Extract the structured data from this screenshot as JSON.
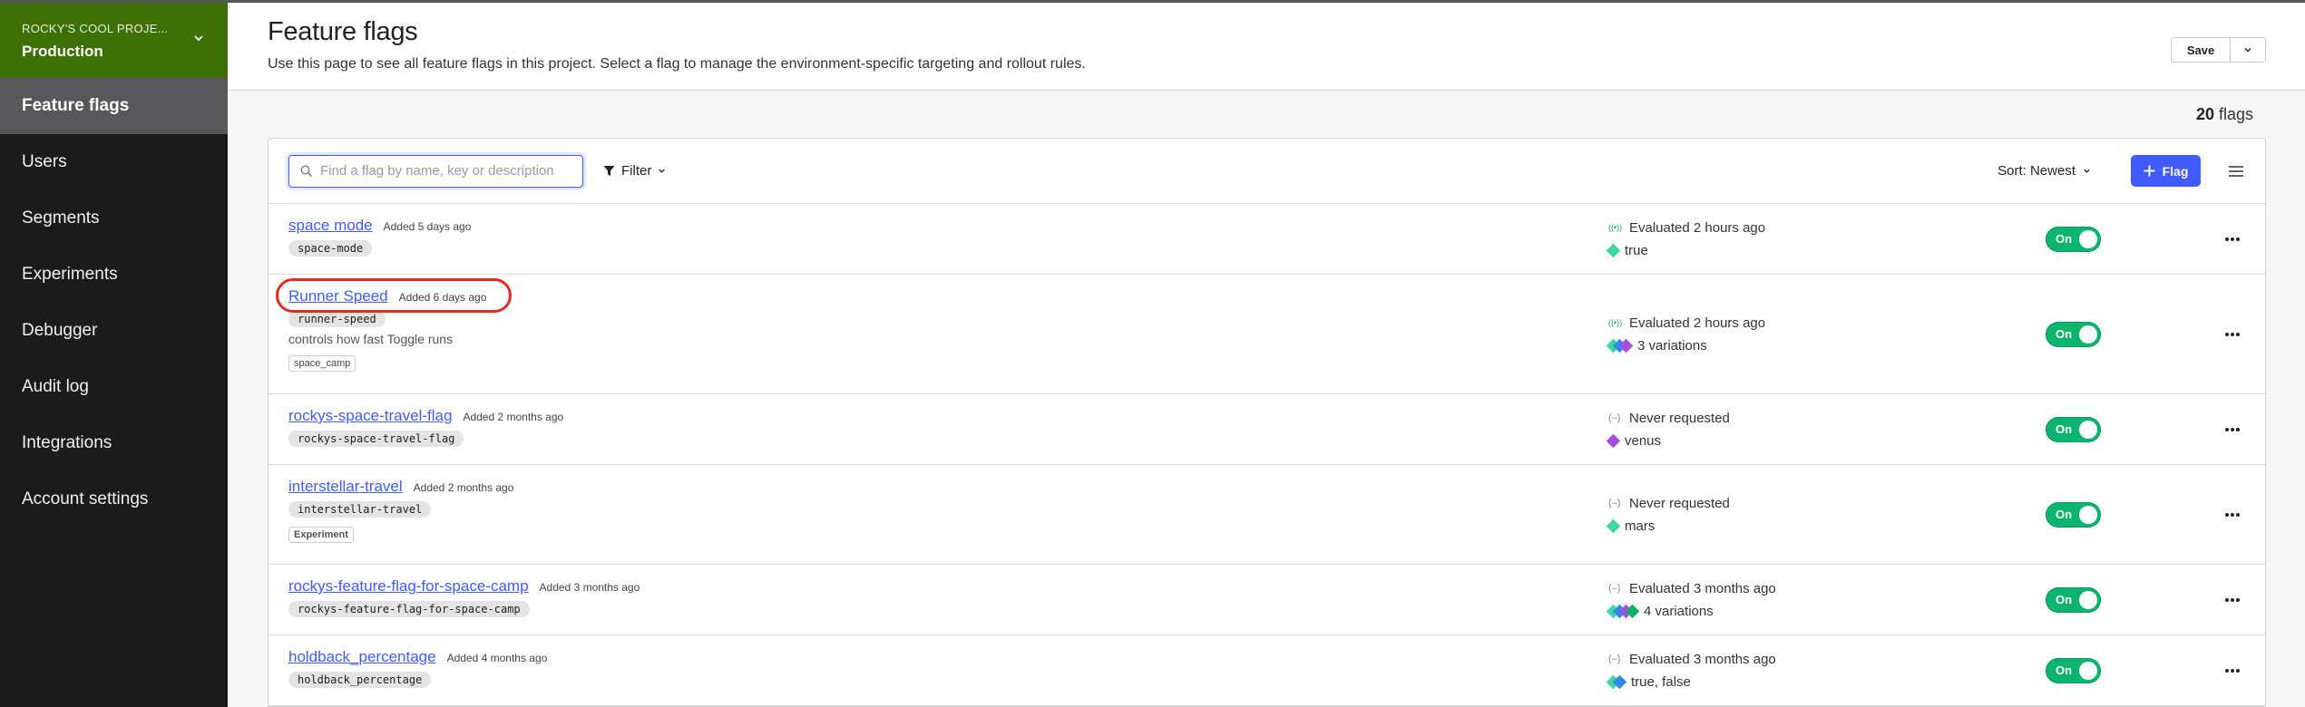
{
  "sidebar": {
    "project_name": "ROCKY'S COOL PROJE...",
    "environment": "Production",
    "items": [
      {
        "label": "Feature flags",
        "active": true
      },
      {
        "label": "Users"
      },
      {
        "label": "Segments"
      },
      {
        "label": "Experiments"
      },
      {
        "label": "Debugger"
      },
      {
        "label": "Audit log"
      },
      {
        "label": "Integrations"
      },
      {
        "label": "Account settings"
      }
    ]
  },
  "header": {
    "title": "Feature flags",
    "description": "Use this page to see all feature flags in this project. Select a flag to manage the environment-specific targeting and rollout rules.",
    "save_label": "Save"
  },
  "summary": {
    "count": "20",
    "count_label": "flags"
  },
  "toolbar": {
    "search_placeholder": "Find a flag by name, key or description",
    "search_value": "",
    "filter_label": "Filter",
    "sort_label": "Sort: Newest",
    "add_flag_label": "Flag"
  },
  "colors": {
    "brand_green": "#3f7006",
    "accent_blue": "#405bff",
    "toggle_on": "#0db46e",
    "highlight_red": "#e8281b",
    "variation_teal": "#3dd6a3",
    "variation_blue": "#2f8ae6",
    "variation_purple": "#a34fde",
    "variation_green": "#0fae63"
  },
  "flags": [
    {
      "name": "space mode",
      "added": "Added 5 days ago",
      "key": "space-mode",
      "status_icon": "live",
      "status": "Evaluated 2 hours ago",
      "variation_colors": [
        "#3dd6a3"
      ],
      "variation_text": "true",
      "toggle": "On"
    },
    {
      "name": "Runner Speed",
      "added": "Added 6 days ago",
      "key": "runner-speed",
      "description": "controls how fast Toggle runs",
      "tag": "space_camp",
      "highlighted": true,
      "status_icon": "live",
      "status": "Evaluated 2 hours ago",
      "variation_colors": [
        "#3dd6a3",
        "#2f8ae6",
        "#a34fde"
      ],
      "variation_text": "3 variations",
      "toggle": "On"
    },
    {
      "name": "rockys-space-travel-flag",
      "added": "Added 2 months ago",
      "key": "rockys-space-travel-flag",
      "status_icon": "idle",
      "status": "Never requested",
      "variation_colors": [
        "#a34fde"
      ],
      "variation_text": "venus",
      "toggle": "On"
    },
    {
      "name": "interstellar-travel",
      "added": "Added 2 months ago",
      "key": "interstellar-travel",
      "tag": "Experiment",
      "status_icon": "idle",
      "status": "Never requested",
      "variation_colors": [
        "#3dd6a3"
      ],
      "variation_text": "mars",
      "toggle": "On"
    },
    {
      "name": "rockys-feature-flag-for-space-camp",
      "added": "Added 3 months ago",
      "key": "rockys-feature-flag-for-space-camp",
      "status_icon": "idle",
      "status": "Evaluated 3 months ago",
      "variation_colors": [
        "#3dd6a3",
        "#2f8ae6",
        "#a34fde",
        "#0fae63"
      ],
      "variation_text": "4 variations",
      "toggle": "On"
    },
    {
      "name": "holdback_percentage",
      "added": "Added 4 months ago",
      "key": "holdback_percentage",
      "status_icon": "idle",
      "status": "Evaluated 3 months ago",
      "variation_colors": [
        "#3dd6a3",
        "#2f8ae6"
      ],
      "variation_text": "true, false",
      "toggle": "On"
    }
  ]
}
